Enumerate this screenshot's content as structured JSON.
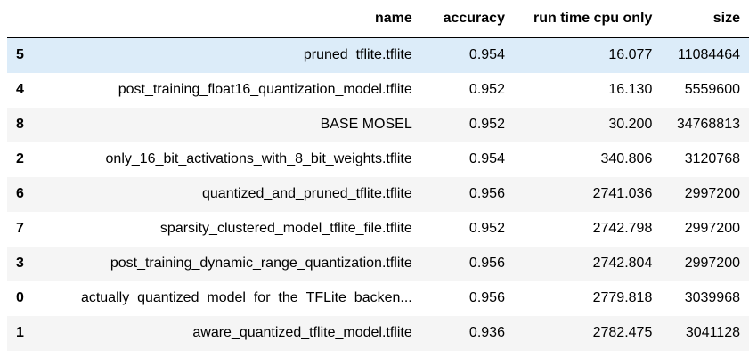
{
  "table": {
    "columns": {
      "index": "",
      "name": "name",
      "accuracy": "accuracy",
      "run_time": "run time cpu only",
      "size": "size"
    },
    "rows": [
      {
        "index": "5",
        "name": "pruned_tflite.tflite",
        "accuracy": "0.954",
        "run_time": "16.077",
        "size": "11084464"
      },
      {
        "index": "4",
        "name": "post_training_float16_quantization_model.tflite",
        "accuracy": "0.952",
        "run_time": "16.130",
        "size": "5559600"
      },
      {
        "index": "8",
        "name": "BASE MOSEL",
        "accuracy": "0.952",
        "run_time": "30.200",
        "size": "34768813"
      },
      {
        "index": "2",
        "name": "only_16_bit_activations_with_8_bit_weights.tflite",
        "accuracy": "0.954",
        "run_time": "340.806",
        "size": "3120768"
      },
      {
        "index": "6",
        "name": "quantized_and_pruned_tflite.tflite",
        "accuracy": "0.956",
        "run_time": "2741.036",
        "size": "2997200"
      },
      {
        "index": "7",
        "name": "sparsity_clustered_model_tflite_file.tflite",
        "accuracy": "0.952",
        "run_time": "2742.798",
        "size": "2997200"
      },
      {
        "index": "3",
        "name": "post_training_dynamic_range_quantization.tflite",
        "accuracy": "0.956",
        "run_time": "2742.804",
        "size": "2997200"
      },
      {
        "index": "0",
        "name": "actually_quantized_model_for_the_TFLite_backen...",
        "accuracy": "0.956",
        "run_time": "2779.818",
        "size": "3039968"
      },
      {
        "index": "1",
        "name": "aware_quantized_tflite_model.tflite",
        "accuracy": "0.936",
        "run_time": "2782.475",
        "size": "3041128"
      }
    ],
    "hovered_row": 0,
    "colors": {
      "stripe": "#f5f5f5",
      "hover": "#dcecf9",
      "header_rule": "#000000"
    }
  }
}
